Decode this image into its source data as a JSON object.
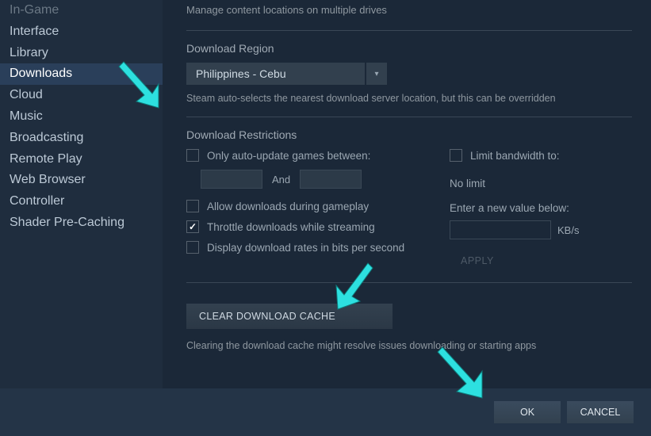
{
  "sidebar": {
    "items": [
      {
        "label": "In-Game"
      },
      {
        "label": "Interface"
      },
      {
        "label": "Library"
      },
      {
        "label": "Downloads"
      },
      {
        "label": "Cloud"
      },
      {
        "label": "Music"
      },
      {
        "label": "Broadcasting"
      },
      {
        "label": "Remote Play"
      },
      {
        "label": "Web Browser"
      },
      {
        "label": "Controller"
      },
      {
        "label": "Shader Pre-Caching"
      }
    ],
    "selected_index": 3
  },
  "content_locations": {
    "subtext": "Manage content locations on multiple drives"
  },
  "download_region": {
    "label": "Download Region",
    "value": "Philippines - Cebu",
    "helper": "Steam auto-selects the nearest download server location, but this can be overridden"
  },
  "restrictions": {
    "label": "Download Restrictions",
    "only_auto_update_label": "Only auto-update games between:",
    "and_label": "And",
    "allow_during_gameplay_label": "Allow downloads during gameplay",
    "throttle_streaming_label": "Throttle downloads while streaming",
    "throttle_streaming_checked": true,
    "display_bits_label": "Display download rates in bits per second",
    "limit_bandwidth_label": "Limit bandwidth to:",
    "no_limit_label": "No limit",
    "enter_value_label": "Enter a new value below:",
    "kbs_label": "KB/s",
    "apply_label": "APPLY"
  },
  "clear_cache": {
    "button_label": "CLEAR DOWNLOAD CACHE",
    "helper": "Clearing the download cache might resolve issues downloading or starting apps"
  },
  "footer": {
    "ok_label": "OK",
    "cancel_label": "CANCEL"
  }
}
